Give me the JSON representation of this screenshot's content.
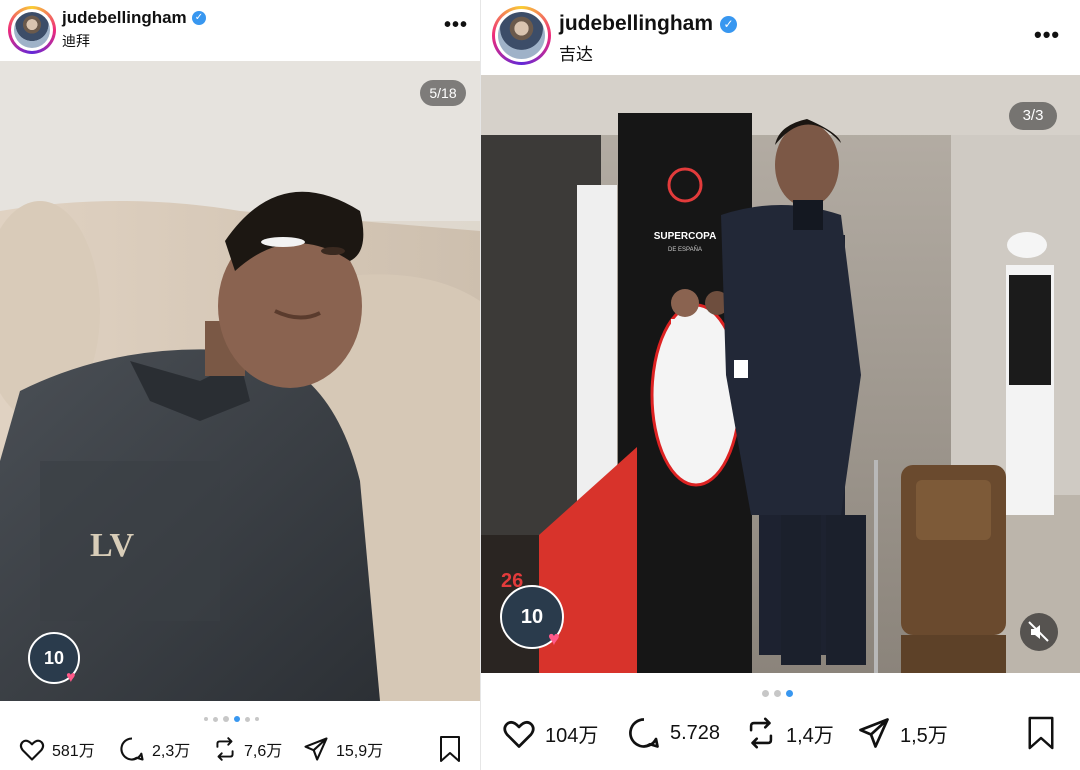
{
  "left_post": {
    "username": "judebellingham",
    "location": "迪拜",
    "verified_icon": "verified-badge-icon",
    "more_icon": "more-options-icon",
    "slide_counter": "5/18",
    "overlay_avatar_number": "10",
    "dots": {
      "total": 6,
      "active": 3
    },
    "actions": {
      "likes": "581万",
      "comments": "2,3万",
      "reposts": "7,6万",
      "shares": "15,9万"
    }
  },
  "right_post": {
    "username": "judebellingham",
    "location": "吉达",
    "verified_icon": "verified-badge-icon",
    "more_icon": "more-options-icon",
    "slide_counter": "3/3",
    "overlay_avatar_number": "10",
    "poster_number": "26",
    "poster_brand": "SUPERCOPA",
    "poster_sub": "DE ESPAÑA",
    "dots": {
      "total": 3,
      "active": 3
    },
    "actions": {
      "likes": "104万",
      "comments": "5.728",
      "reposts": "1,4万",
      "shares": "1,5万"
    }
  },
  "colors": {
    "accent": "#3897f0",
    "text": "#111111",
    "heart": "#ff5a8a"
  }
}
